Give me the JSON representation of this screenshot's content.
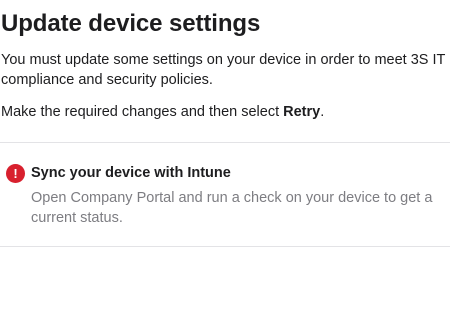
{
  "header": {
    "title": "Update device settings"
  },
  "body": {
    "description": "You must update some settings on your device in order to meet 3S IT compliance and security policies.",
    "instruction_prefix": "Make the required changes and then select ",
    "instruction_action": "Retry",
    "instruction_suffix": "."
  },
  "requirements": [
    {
      "icon": "error-icon",
      "icon_glyph": "!",
      "icon_color": "#d8202e",
      "title": "Sync your device with Intune",
      "description": "Open Company Portal and run a check on your device to get a current status."
    }
  ]
}
